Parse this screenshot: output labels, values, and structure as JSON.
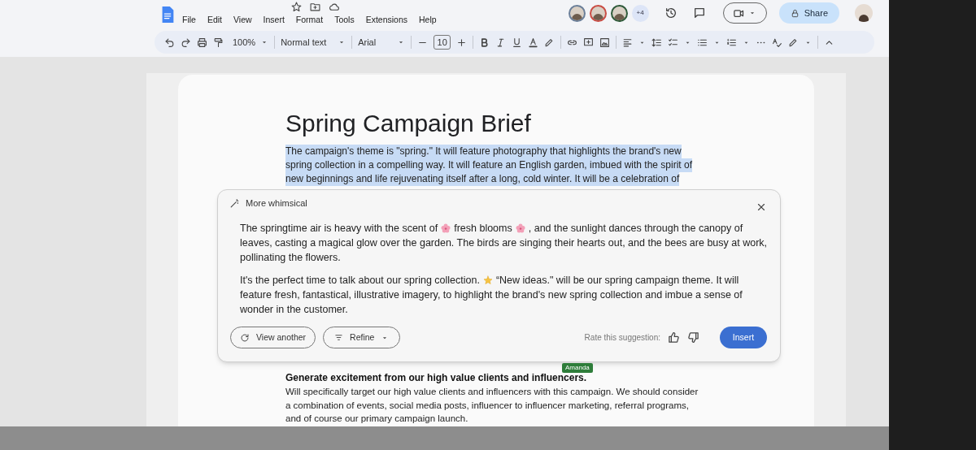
{
  "menu": [
    "File",
    "Edit",
    "View",
    "Insert",
    "Format",
    "Tools",
    "Extensions",
    "Help"
  ],
  "collaborators": {
    "more": "+4"
  },
  "share_button": "Share",
  "toolbar": {
    "zoom": "100%",
    "style": "Normal text",
    "font": "Arial",
    "font_size": "10"
  },
  "document": {
    "title": "Spring Campaign Brief",
    "selected_lines": [
      "The campaign's theme is \"spring.\" It will feature photography that highlights the brand's new",
      "spring collection in a compelling way. It will feature an English garden, imbued with the spirit of",
      "new beginnings and life rejuvenating itself after a long, cold winter. It will be a celebration of"
    ],
    "section_heading": "Generate excitement from our high value clients and influencers.",
    "cursor_tag": "Amanda",
    "section_body": "Will specifically target our high value clients and influencers with this campaign. We should consider a combination of events, social media posts, influencer to influencer marketing, referral programs, and of course our primary campaign launch."
  },
  "suggestion": {
    "title": "More whimsical",
    "paragraphs": [
      [
        [
          {
            "kind": "text",
            "text": "The springtime air is heavy with the scent of"
          },
          {
            "kind": "blossom"
          },
          {
            "kind": "text",
            "text": "fresh blooms"
          },
          {
            "kind": "blossom"
          },
          {
            "kind": "text",
            "text": ", and the sunlight dances through the canopy of"
          }
        ],
        [
          {
            "kind": "text",
            "text": "leaves, casting a magical glow over the garden. The birds are singing their hearts out, and the bees are busy at work,"
          }
        ],
        [
          {
            "kind": "text",
            "text": "pollinating the flowers."
          }
        ]
      ],
      [
        [
          {
            "kind": "text",
            "text": "It's the perfect time to talk about our spring collection."
          },
          {
            "kind": "star"
          },
          {
            "kind": "text",
            "text": "“New ideas.\" will be our spring campaign theme. It will"
          }
        ],
        [
          {
            "kind": "text",
            "text": "feature fresh, fantastical, illustrative imagery, to highlight the brand's new spring collection and imbue a sense of"
          }
        ],
        [
          {
            "kind": "text",
            "text": "wonder in the customer."
          }
        ]
      ]
    ],
    "view_another": "View another",
    "refine": "Refine",
    "rate_label": "Rate this suggestion:",
    "insert": "Insert"
  }
}
